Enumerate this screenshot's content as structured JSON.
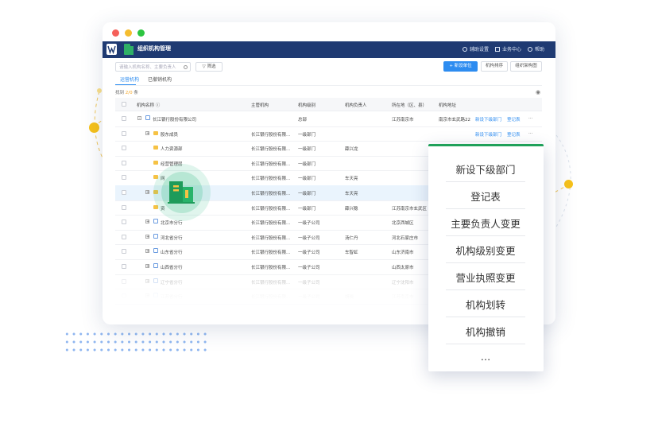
{
  "app": {
    "title": "组织机构管理",
    "links": [
      "辅助设置",
      "业务中心",
      "帮助"
    ]
  },
  "toolbar": {
    "search_placeholder": "请输入机构名称、主要负责人",
    "filter_label": "筛选",
    "new_label": "新设单位",
    "sort_label": "机构排序",
    "chart_label": "组织架构图"
  },
  "tabs": [
    "运营机构",
    "已撤销机构"
  ],
  "found": {
    "prefix": "找到",
    "count": "2/0",
    "suffix": "条"
  },
  "columns": [
    "机构名称",
    "主管机构",
    "机构级别",
    "机构负责人",
    "所在地（区、县）",
    "机构地址"
  ],
  "rows": [
    {
      "name": "长江银行股份有限公司",
      "parent": "",
      "level": "总部",
      "head": "",
      "loc": "江苏南京市",
      "addr": "南京市玄武路22",
      "icon": "bank-icon",
      "indent": 1,
      "expand": "-",
      "actions": [
        "新设下级部门",
        "登记表",
        "···"
      ]
    },
    {
      "name": "股东成员",
      "parent": "长江银行股份有限...",
      "level": "一级部门",
      "head": "",
      "loc": "",
      "addr": "",
      "icon": "folder-icon",
      "indent": 2,
      "expand": "+",
      "actions": [
        "新设下级部门",
        "登记表",
        "···"
      ]
    },
    {
      "name": "人力资源部",
      "parent": "长江银行股份有限...",
      "level": "一级部门",
      "head": "薛兴龙",
      "loc": "",
      "addr": "",
      "icon": "folder-icon",
      "indent": 2,
      "expand": "",
      "actions": []
    },
    {
      "name": "经营管理层",
      "parent": "长江银行股份有限...",
      "level": "一级部门",
      "head": "",
      "loc": "",
      "addr": "",
      "icon": "folder-icon",
      "indent": 2,
      "expand": "",
      "actions": []
    },
    {
      "name": "网",
      "parent": "长江银行股份有限...",
      "level": "一级部门",
      "head": "车天亮",
      "loc": "",
      "addr": "",
      "icon": "folder-icon",
      "indent": 2,
      "expand": "",
      "actions": []
    },
    {
      "name": "",
      "parent": "长江银行股份有限...",
      "level": "一级部门",
      "head": "车天亮",
      "loc": "",
      "addr": "",
      "icon": "folder-icon",
      "indent": 2,
      "expand": "+",
      "actions": []
    },
    {
      "name": "资",
      "parent": "长江银行股份有限...",
      "level": "一级部门",
      "head": "薛兴稳",
      "loc": "江苏南京市玄武区",
      "addr": "",
      "icon": "folder-icon",
      "indent": 2,
      "expand": "",
      "actions": []
    },
    {
      "name": "北京市分行",
      "parent": "长江银行股份有限...",
      "level": "一级子公司",
      "head": "",
      "loc": "北京西城区",
      "addr": "",
      "icon": "bank-icon",
      "indent": 2,
      "expand": "+",
      "actions": []
    },
    {
      "name": "河北省分行",
      "parent": "长江银行股份有限...",
      "level": "一级子公司",
      "head": "汤仁丹",
      "loc": "河北石家庄市",
      "addr": "",
      "icon": "bank-icon",
      "indent": 2,
      "expand": "+",
      "actions": []
    },
    {
      "name": "山东省分行",
      "parent": "长江银行股份有限...",
      "level": "一级子公司",
      "head": "车智虹",
      "loc": "山东济南市",
      "addr": "",
      "icon": "bank-icon",
      "indent": 2,
      "expand": "+",
      "actions": []
    },
    {
      "name": "山西省分行",
      "parent": "长江银行股份有限...",
      "level": "一级子公司",
      "head": "",
      "loc": "山西太原市",
      "addr": "",
      "icon": "bank-icon",
      "indent": 2,
      "expand": "+",
      "actions": []
    },
    {
      "name": "辽宁省分行",
      "parent": "长江银行股份有限...",
      "level": "一级子公司",
      "head": "",
      "loc": "辽宁沈阳市",
      "addr": "",
      "icon": "bank-icon",
      "indent": 2,
      "expand": "+",
      "actions": []
    },
    {
      "name": "江苏省分行",
      "parent": "长江银行股份有限...",
      "level": "一级子公司",
      "head": "胡晓",
      "loc": "江苏南京市",
      "addr": "",
      "icon": "bank-icon",
      "indent": 2,
      "expand": "+",
      "actions": []
    }
  ],
  "popup_menu": [
    "新设下级部门",
    "登记表",
    "主要负责人变更",
    "机构级别变更",
    "营业执照变更",
    "机构划转",
    "机构撤销",
    "…"
  ],
  "colors": {
    "brand": "#1f3a72",
    "accent": "#2d8cf0",
    "green": "#20a15a",
    "yellow": "#f7c21a"
  }
}
